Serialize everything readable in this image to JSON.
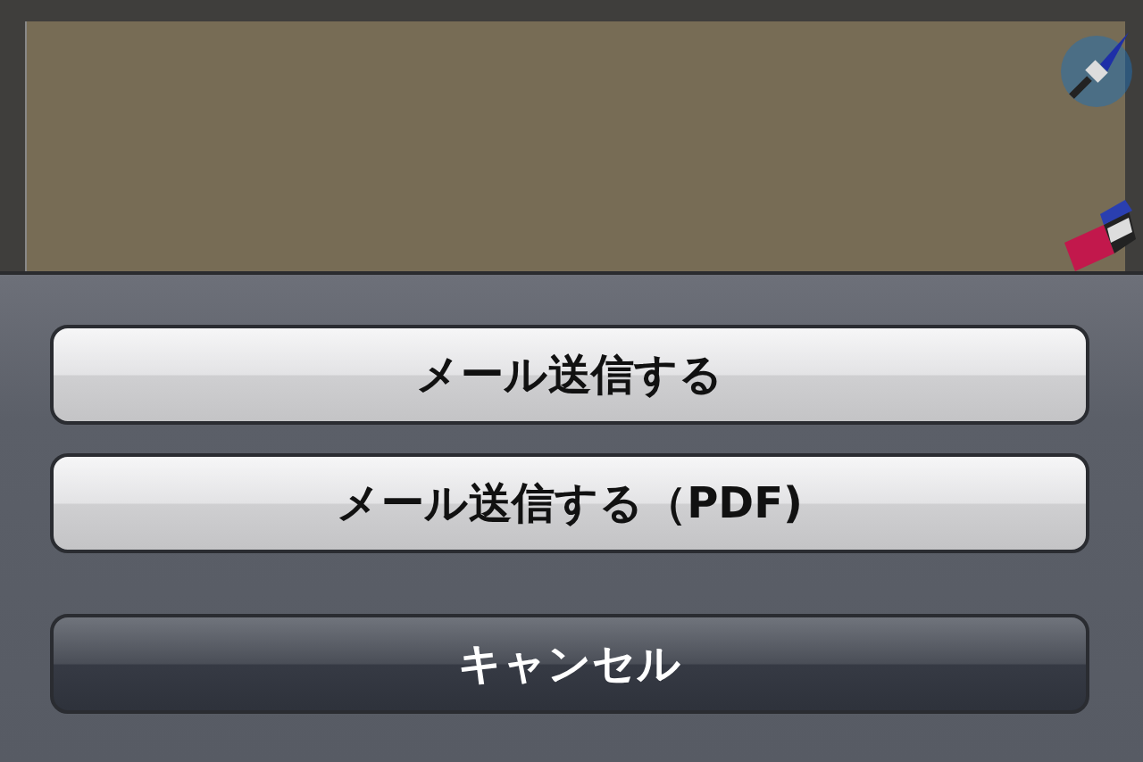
{
  "action_sheet": {
    "buttons": [
      {
        "label": "メール送信する",
        "kind": "default"
      },
      {
        "label": "メール送信する（PDF)",
        "kind": "default"
      },
      {
        "label": "キャンセル",
        "kind": "cancel"
      }
    ]
  }
}
